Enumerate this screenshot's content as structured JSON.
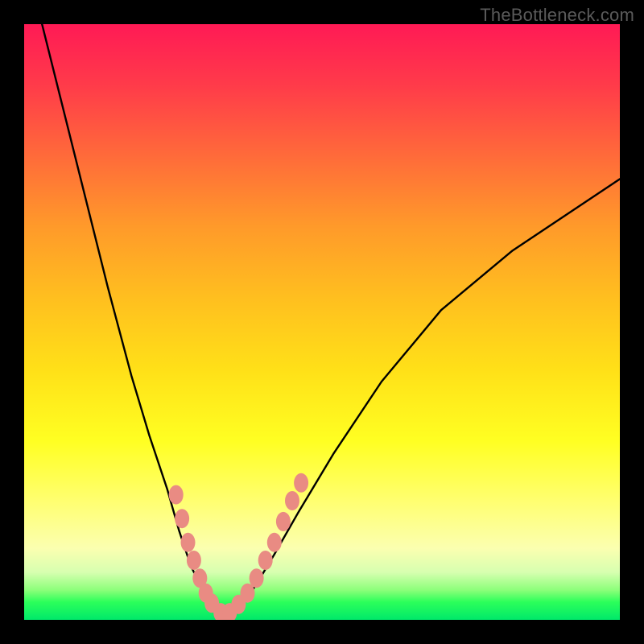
{
  "watermark": "TheBottleneck.com",
  "chart_data": {
    "type": "line",
    "title": "",
    "xlabel": "",
    "ylabel": "",
    "xlim": [
      0,
      100
    ],
    "ylim": [
      0,
      100
    ],
    "grid": false,
    "legend": false,
    "series": [
      {
        "name": "curve",
        "x": [
          3,
          6,
          10,
          14,
          18,
          21,
          24,
          26,
          28,
          30,
          31,
          32,
          33.5,
          35,
          37,
          39,
          42,
          46,
          52,
          60,
          70,
          82,
          94,
          100
        ],
        "y": [
          100,
          88,
          72,
          56,
          41,
          31,
          22,
          15,
          9,
          5,
          3,
          1.5,
          0.8,
          1.2,
          3,
          6,
          11,
          18,
          28,
          40,
          52,
          62,
          70,
          74
        ]
      }
    ],
    "markers": {
      "comment": "salmon bead clusters near the valley",
      "color": "#e98b83",
      "points": [
        {
          "x": 25.5,
          "y": 21
        },
        {
          "x": 26.5,
          "y": 17
        },
        {
          "x": 27.5,
          "y": 13
        },
        {
          "x": 28.5,
          "y": 10
        },
        {
          "x": 29.5,
          "y": 7
        },
        {
          "x": 30.5,
          "y": 4.5
        },
        {
          "x": 31.5,
          "y": 2.8
        },
        {
          "x": 33.0,
          "y": 1.2
        },
        {
          "x": 34.5,
          "y": 1.2
        },
        {
          "x": 36.0,
          "y": 2.6
        },
        {
          "x": 37.5,
          "y": 4.5
        },
        {
          "x": 39.0,
          "y": 7
        },
        {
          "x": 40.5,
          "y": 10
        },
        {
          "x": 42.0,
          "y": 13
        },
        {
          "x": 43.5,
          "y": 16.5
        },
        {
          "x": 45.0,
          "y": 20
        },
        {
          "x": 46.5,
          "y": 23
        }
      ]
    }
  }
}
